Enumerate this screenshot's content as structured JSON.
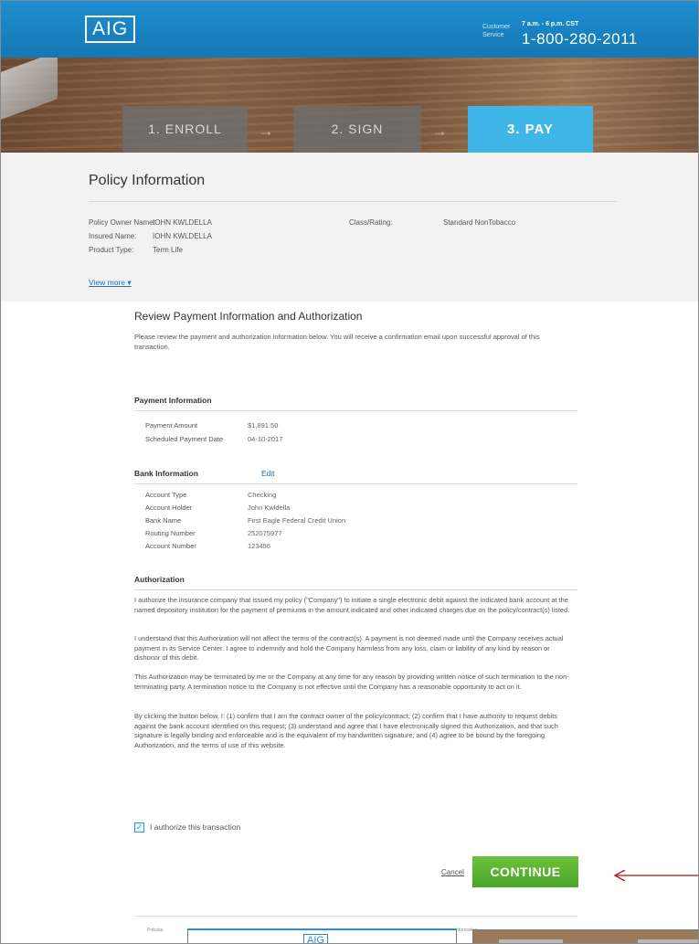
{
  "header": {
    "logo": "AIG",
    "customer_service_label": "Customer\nService",
    "hours": "7 a.m. - 6 p.m. CST",
    "phone": "1-800-280-2011"
  },
  "steps": {
    "enroll": "1. ENROLL",
    "sign": "2. SIGN",
    "pay": "3. PAY",
    "active": "pay"
  },
  "policy": {
    "title": "Policy Information",
    "owner_label": "Policy Owner Name:",
    "owner_value": "IOHN KWLDELLA",
    "insured_label": "Insured Name:",
    "insured_value": "IOHN KWLDELLA",
    "product_label": "Product Type:",
    "product_value": "Term Life",
    "class_label": "Class/Rating:",
    "class_value": "Standard NonTobacco",
    "view_more": "View more ▾"
  },
  "review": {
    "title": "Review Payment Information and Authorization",
    "intro": "Please review the payment and authorization information below. You will receive a confirmation email upon successful approval of this transaction.",
    "payment_heading": "Payment Information",
    "payment_rows": [
      {
        "label": "Payment Amount",
        "value": "$1,891.50"
      },
      {
        "label": "Scheduled Payment Date",
        "value": "04-10-2017"
      }
    ],
    "bank_heading": "Bank Information",
    "bank_edit": "Edit",
    "bank_rows": [
      {
        "label": "Account Type",
        "value": "Checking"
      },
      {
        "label": "Account Holder",
        "value": "John Kwldella"
      },
      {
        "label": "Bank Name",
        "value": "First Eagle Federal Credit Union"
      },
      {
        "label": "Routing Number",
        "value": "252075977"
      },
      {
        "label": "Account Number",
        "value": "123456"
      }
    ],
    "authorization_heading": "Authorization",
    "authorization_paragraphs": [
      "I authorize the insurance company that issued my policy (\"Company\") to initiate a single electronic debit against the indicated bank account at the named depository institution for the payment of premiums in the amount indicated and other indicated charges due on the policy/contract(s) listed.",
      "I understand that this Authorization will not affect the terms of the contract(s). A payment is not deemed made until the Company receives actual payment in its Service Center. I agree to indemnify and hold the Company harmless from any loss, claim or liability of any kind by reason or dishonor of this debit.",
      "This Authorization may be terminated by me or the Company at any time for any reason by providing written notice of such termination to the non-terminating party. A termination notice to the Company is not effective until the Company has a reasonable opportunity to act on it.",
      "By clicking the button below, I: (1) confirm that I am the contract owner of the policy/contract; (2) confirm that I have authority to request debits against the bank account identified on this request; (3) understand and agree that I have electronically signed this Authorization, and that such signature is legally binding and enforceable and is the equivalent of my handwritten signature; and (4) agree to be bound by the foregoing Authorization, and the terms of use of this website."
    ],
    "authorize_checkbox_label": "I authorize this transaction",
    "authorize_checked": true,
    "cancel": "Cancel",
    "continue": "CONTINUE"
  },
  "footer": {
    "left": "Policies",
    "right": "information"
  },
  "overlay": {
    "logo": "AIG"
  },
  "colors": {
    "header_blue": "#1d8fd0",
    "active_step": "#3fb6e8",
    "continue_green": "#5bb331",
    "link_blue": "#1a72b8",
    "annotation_arrow": "#b01515"
  }
}
